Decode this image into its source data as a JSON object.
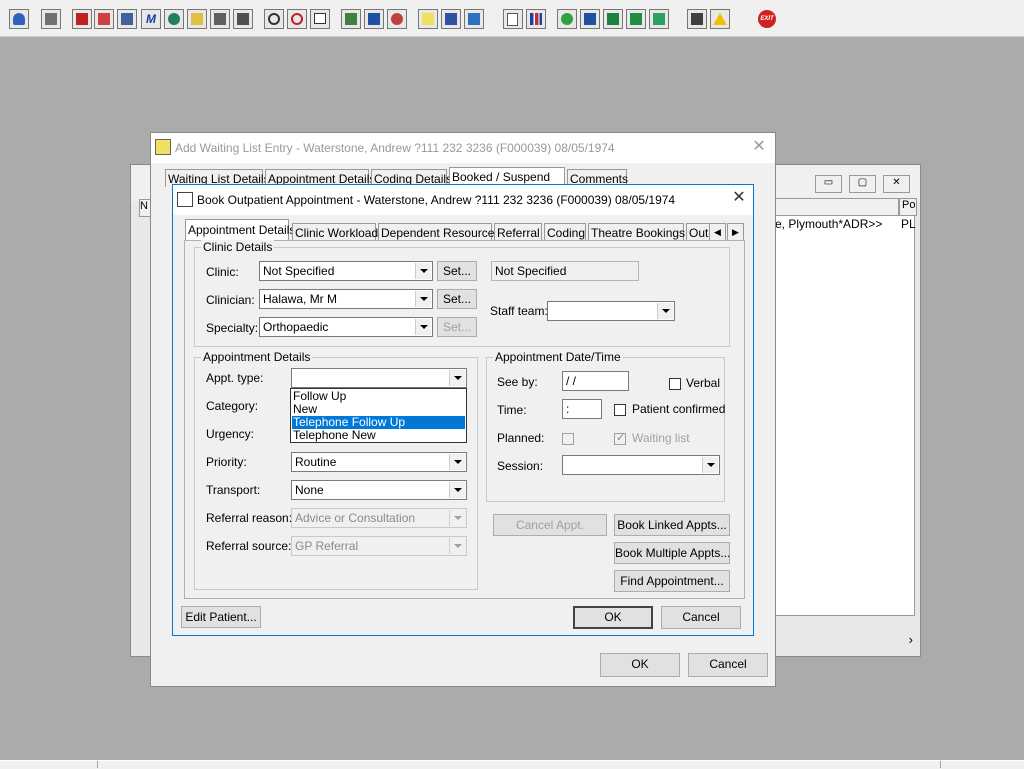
{
  "toolbar": {
    "icons": [
      "patient-icon",
      "print-icon",
      "books-icon",
      "edit-icon",
      "list-icon",
      "m-icon",
      "person-icon",
      "notes-icon",
      "ambulance-icon",
      "bed-icon",
      "search-icon",
      "clock-icon",
      "monitor-icon",
      "monitor-person-icon",
      "monitor-list-icon",
      "monitor-clock-icon",
      "note-icon",
      "waiting-list-icon",
      "waiting-list-2-icon",
      "document-icon",
      "chart-icon",
      "globe-icon",
      "edit-doc-icon",
      "download-icon",
      "transfer-icon",
      "swap-icon",
      "warning-icon",
      "exit-icon"
    ]
  },
  "bg_window": {
    "col_header": "Po",
    "row_text": "e, Plymouth*ADR>>",
    "row_suffix": "PL",
    "small_col": "N"
  },
  "waiting_dialog": {
    "title": "Add Waiting List Entry - Waterstone, Andrew ?111 232 3236 (F000039) 08/05/1974",
    "tabs": [
      "Waiting List Details",
      "Appointment Details",
      "Coding Details",
      "Booked / Suspend",
      "Comments"
    ],
    "active_tab": 3,
    "ok_label": "OK",
    "cancel_label": "Cancel"
  },
  "booking_dialog": {
    "title": "Book Outpatient Appointment - Waterstone, Andrew ?111 232 3236 (F000039) 08/05/1974",
    "tabs": [
      "Appointment Details",
      "Clinic Workload",
      "Dependent Resources",
      "Referral",
      "Coding",
      "Theatre Bookings",
      "Out"
    ],
    "active_tab": 0,
    "clinic_details": {
      "group_label": "Clinic Details",
      "clinic_label": "Clinic:",
      "clinic_value": "Not Specified",
      "clinic_display": "Not Specified",
      "clinician_label": "Clinician:",
      "clinician_value": "Halawa, Mr M",
      "specialty_label": "Specialty:",
      "specialty_value": "Orthopaedic",
      "set_label": "Set...",
      "staff_team_label": "Staff team:",
      "staff_team_value": ""
    },
    "appointment_details": {
      "group_label": "Appointment Details",
      "appt_type_label": "Appt. type:",
      "appt_type_value": "",
      "appt_type_options": [
        "Follow Up",
        "New",
        "Telephone Follow Up",
        "Telephone New"
      ],
      "appt_type_highlighted": 2,
      "category_label": "Category:",
      "urgency_label": "Urgency:",
      "priority_label": "Priority:",
      "priority_value": "Routine",
      "transport_label": "Transport:",
      "transport_value": "None",
      "referral_reason_label": "Referral reason:",
      "referral_reason_value": "Advice or Consultation",
      "referral_source_label": "Referral source:",
      "referral_source_value": "GP Referral"
    },
    "date_time": {
      "group_label": "Appointment Date/Time",
      "see_by_label": "See by:",
      "see_by_value": " /  /",
      "verbal_label": "Verbal",
      "time_label": "Time:",
      "time_value": " :",
      "patient_confirmed_label": "Patient confirmed",
      "planned_label": "Planned:",
      "waiting_list_label": "Waiting list",
      "session_label": "Session:",
      "session_value": ""
    },
    "buttons": {
      "cancel_appt": "Cancel Appt.",
      "book_linked": "Book Linked Appts...",
      "book_multiple": "Book Multiple Appts...",
      "find_appointment": "Find Appointment...",
      "edit_patient": "Edit Patient...",
      "ok": "OK",
      "cancel": "Cancel"
    }
  }
}
